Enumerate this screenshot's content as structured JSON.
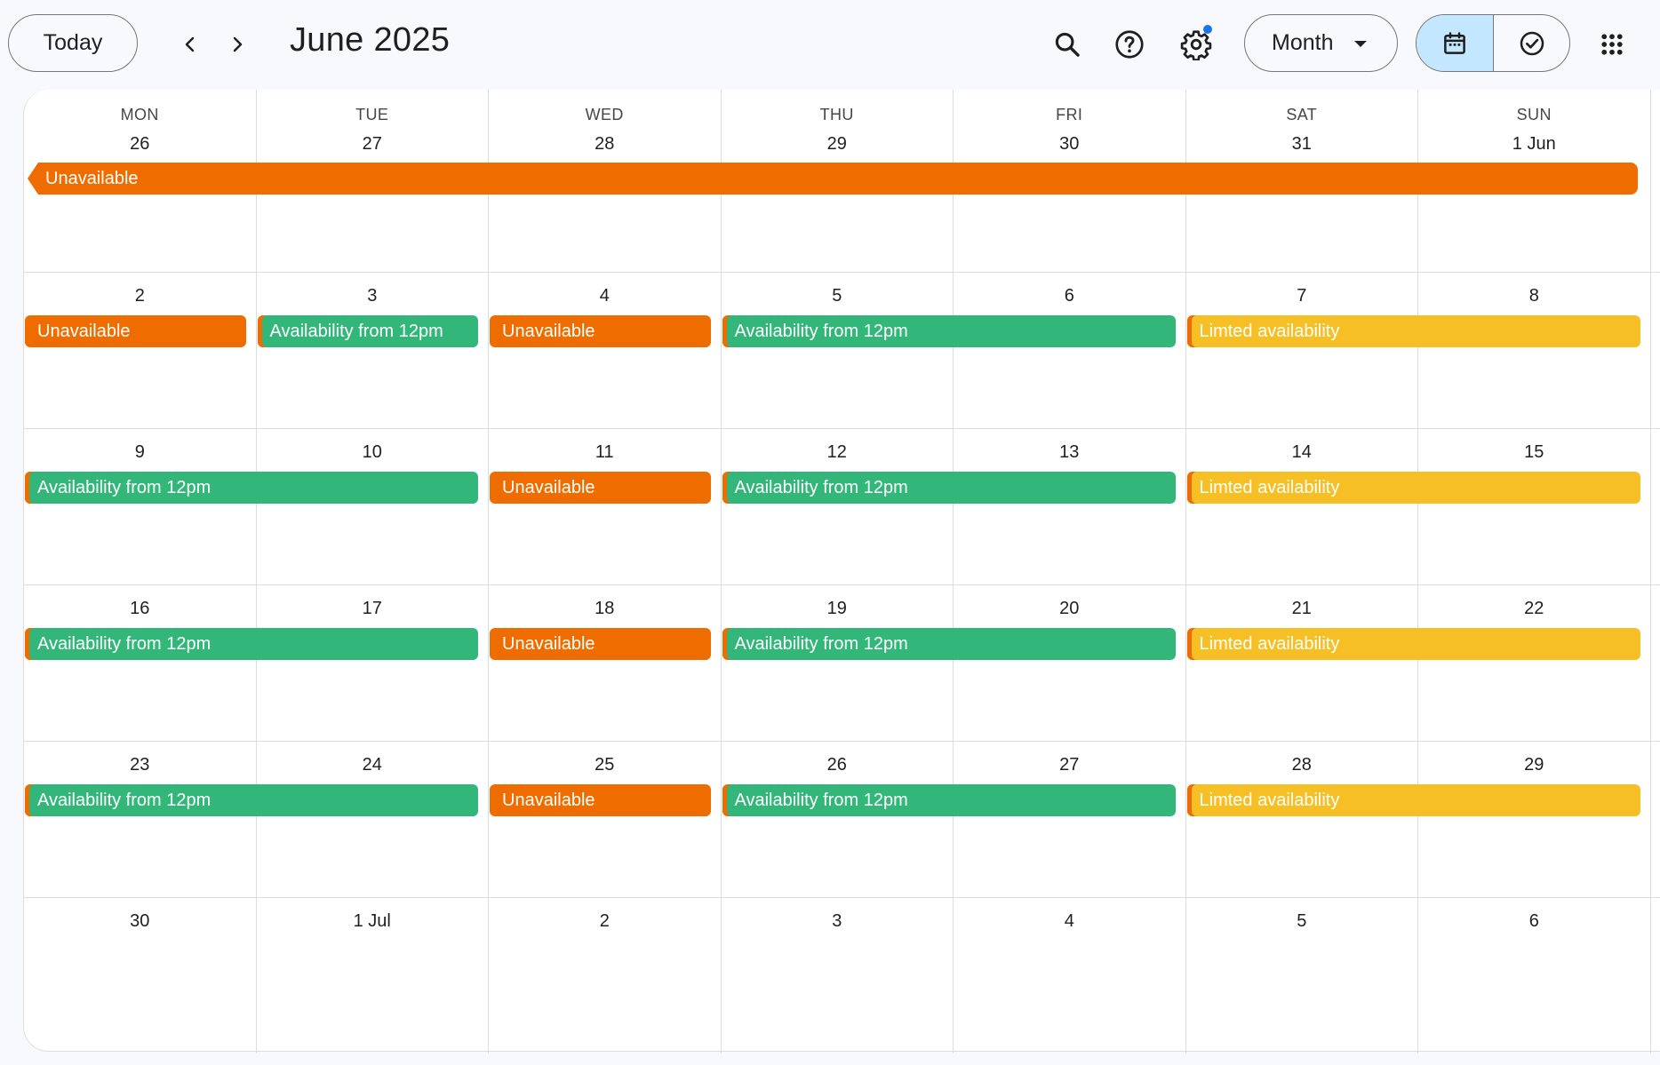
{
  "header": {
    "today_label": "Today",
    "title": "June 2025",
    "view_label": "Month"
  },
  "colors": {
    "unavailable": "#ef6c00",
    "availability": "#33b679",
    "limited": "#f6bf26",
    "accent": "#1a73e8",
    "active_toggle": "#c2e7ff"
  },
  "icons": [
    "chevron-left-icon",
    "chevron-right-icon",
    "search-icon",
    "help-icon",
    "settings-icon",
    "calendar-icon",
    "tasks-check-icon",
    "apps-grid-icon"
  ],
  "weekdays": [
    "MON",
    "TUE",
    "WED",
    "THU",
    "FRI",
    "SAT",
    "SUN"
  ],
  "weeks": [
    {
      "days": [
        "26",
        "27",
        "28",
        "29",
        "30",
        "31",
        "1 Jun"
      ]
    },
    {
      "days": [
        "2",
        "3",
        "4",
        "5",
        "6",
        "7",
        "8"
      ]
    },
    {
      "days": [
        "9",
        "10",
        "11",
        "12",
        "13",
        "14",
        "15"
      ]
    },
    {
      "days": [
        "16",
        "17",
        "18",
        "19",
        "20",
        "21",
        "22"
      ]
    },
    {
      "days": [
        "23",
        "24",
        "25",
        "26",
        "27",
        "28",
        "29"
      ]
    },
    {
      "days": [
        "30",
        "1 Jul",
        "2",
        "3",
        "4",
        "5",
        "6"
      ]
    }
  ],
  "events": [
    {
      "week": 0,
      "start": 0,
      "span": 7,
      "type": "orange",
      "label": "Unavailable"
    },
    {
      "week": 1,
      "start": 0,
      "span": 1,
      "type": "orange",
      "label": "Unavailable"
    },
    {
      "week": 1,
      "start": 1,
      "span": 1,
      "type": "green",
      "label": "Availability from 12pm"
    },
    {
      "week": 1,
      "start": 2,
      "span": 1,
      "type": "orange",
      "label": "Unavailable"
    },
    {
      "week": 1,
      "start": 3,
      "span": 2,
      "type": "green",
      "label": "Availability from 12pm"
    },
    {
      "week": 1,
      "start": 5,
      "span": 2,
      "type": "yellow",
      "label": "Limted availability"
    },
    {
      "week": 2,
      "start": 0,
      "span": 2,
      "type": "green",
      "label": "Availability from 12pm"
    },
    {
      "week": 2,
      "start": 2,
      "span": 1,
      "type": "orange",
      "label": "Unavailable"
    },
    {
      "week": 2,
      "start": 3,
      "span": 2,
      "type": "green",
      "label": "Availability from 12pm"
    },
    {
      "week": 2,
      "start": 5,
      "span": 2,
      "type": "yellow",
      "label": "Limted availability"
    },
    {
      "week": 3,
      "start": 0,
      "span": 2,
      "type": "green",
      "label": "Availability from 12pm"
    },
    {
      "week": 3,
      "start": 2,
      "span": 1,
      "type": "orange",
      "label": "Unavailable"
    },
    {
      "week": 3,
      "start": 3,
      "span": 2,
      "type": "green",
      "label": "Availability from 12pm"
    },
    {
      "week": 3,
      "start": 5,
      "span": 2,
      "type": "yellow",
      "label": "Limted availability"
    },
    {
      "week": 4,
      "start": 0,
      "span": 2,
      "type": "green",
      "label": "Availability from 12pm"
    },
    {
      "week": 4,
      "start": 2,
      "span": 1,
      "type": "orange",
      "label": "Unavailable"
    },
    {
      "week": 4,
      "start": 3,
      "span": 2,
      "type": "green",
      "label": "Availability from 12pm"
    },
    {
      "week": 4,
      "start": 5,
      "span": 2,
      "type": "yellow",
      "label": "Limted availability"
    }
  ]
}
